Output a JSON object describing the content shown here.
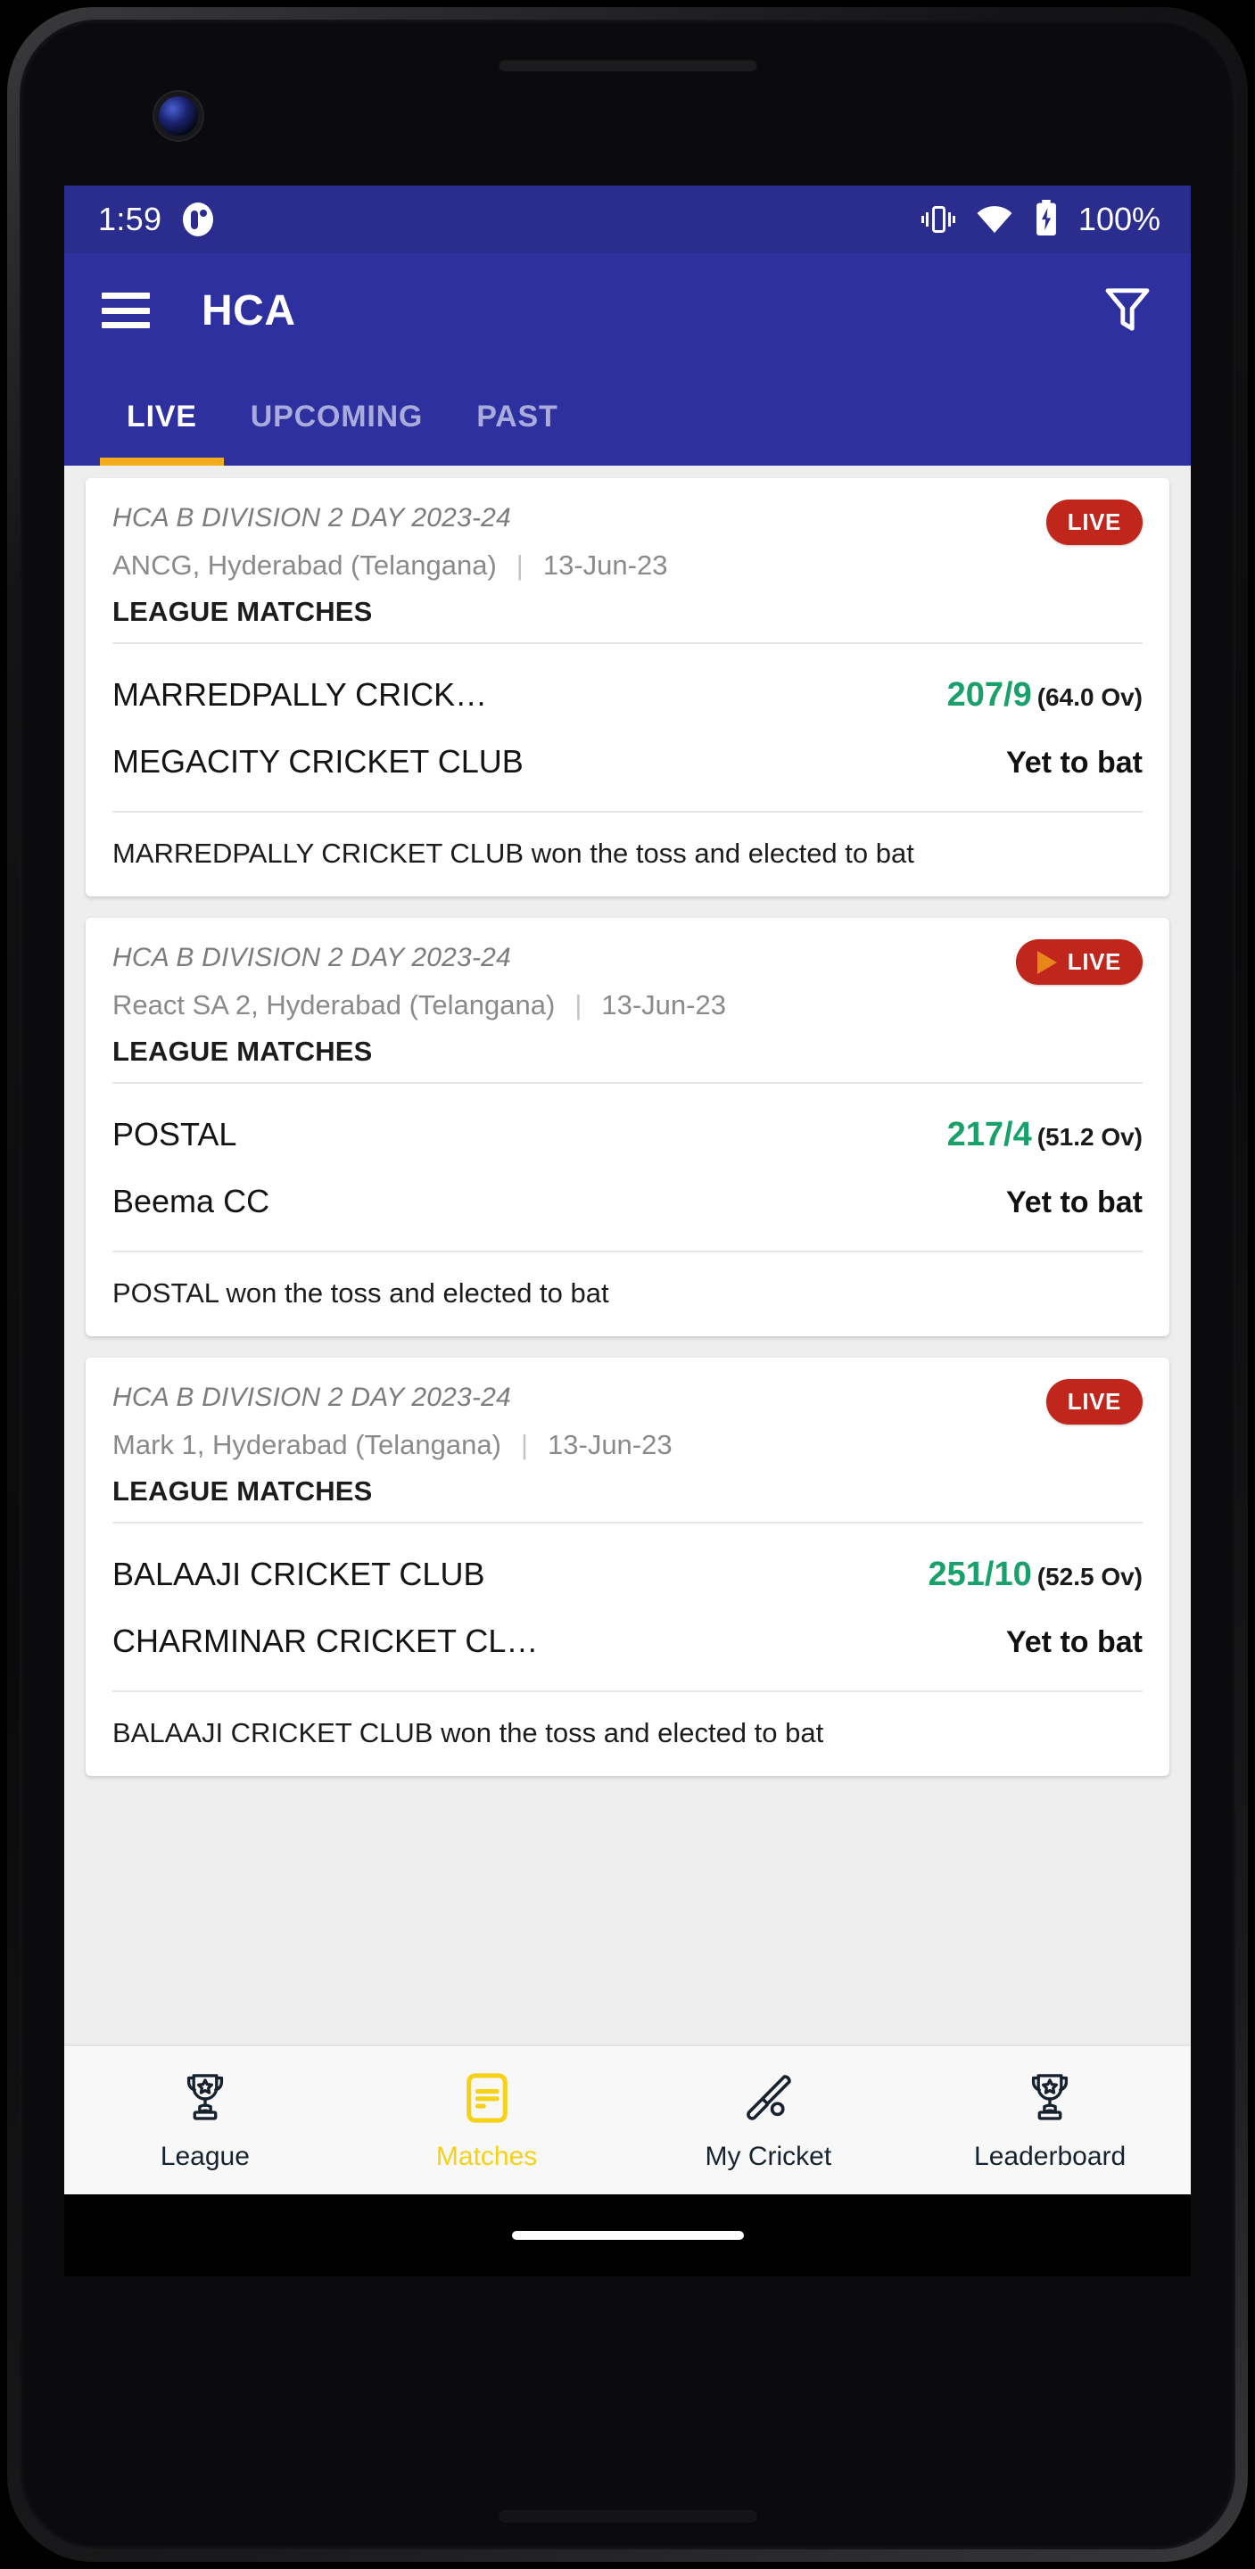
{
  "status_bar": {
    "time": "1:59",
    "notification_icon": "app-notification-icon",
    "vibrate_icon": "vibrate-icon",
    "wifi_icon": "wifi-icon",
    "battery_icon": "battery-charging-icon",
    "battery_level": "100%"
  },
  "app_bar": {
    "menu_icon": "hamburger-menu-icon",
    "title": "HCA",
    "filter_icon": "filter-icon"
  },
  "tabs": [
    {
      "label": "LIVE",
      "active": true
    },
    {
      "label": "UPCOMING",
      "active": false
    },
    {
      "label": "PAST",
      "active": false
    }
  ],
  "colors": {
    "status_bar_blue": "#2b2d8e",
    "app_bar_blue": "#2e30a0",
    "tab_indicator_yellow": "#f5ac1d",
    "live_badge_red": "#c0261b",
    "play_icon_orange": "#e8861b",
    "score_green": "#19a06b",
    "active_nav_yellow": "#f5d117",
    "page_background": "#eeeeee"
  },
  "matches": [
    {
      "tournament": "HCA B DIVISION 2 DAY 2023-24",
      "venue": "ANCG, Hyderabad (Telangana)",
      "separator": "|",
      "date": "13-Jun-23",
      "round": "LEAGUE MATCHES",
      "badge": {
        "label": "LIVE",
        "has_play_icon": false
      },
      "team_a": {
        "name": "MARREDPALLY CRICK…",
        "runs": "207/9",
        "overs": "(64.0 Ov)"
      },
      "team_b": {
        "name": "MEGACITY CRICKET CLUB",
        "status": "Yet to bat"
      },
      "toss": "MARREDPALLY CRICKET CLUB won the toss and elected to bat"
    },
    {
      "tournament": "HCA B DIVISION 2 DAY 2023-24",
      "venue": "React SA 2, Hyderabad (Telangana)",
      "separator": "|",
      "date": "13-Jun-23",
      "round": "LEAGUE MATCHES",
      "badge": {
        "label": "LIVE",
        "has_play_icon": true
      },
      "team_a": {
        "name": "POSTAL",
        "runs": "217/4",
        "overs": "(51.2 Ov)"
      },
      "team_b": {
        "name": "Beema CC",
        "status": "Yet to bat"
      },
      "toss": "POSTAL won the toss and elected to bat"
    },
    {
      "tournament": "HCA B DIVISION 2 DAY 2023-24",
      "venue": "Mark 1, Hyderabad (Telangana)",
      "separator": "|",
      "date": "13-Jun-23",
      "round": "LEAGUE MATCHES",
      "badge": {
        "label": "LIVE",
        "has_play_icon": false
      },
      "team_a": {
        "name": "BALAAJI CRICKET CLUB",
        "runs": "251/10",
        "overs": "(52.5 Ov)"
      },
      "team_b": {
        "name": "CHARMINAR CRICKET CL…",
        "status": "Yet to bat"
      },
      "toss": "BALAAJI CRICKET CLUB won the toss and elected to bat"
    }
  ],
  "bottom_nav": [
    {
      "label": "League",
      "icon": "trophy-icon",
      "active": false
    },
    {
      "label": "Matches",
      "icon": "matches-list-icon",
      "active": true
    },
    {
      "label": "My Cricket",
      "icon": "cricket-bat-ball-icon",
      "active": false
    },
    {
      "label": "Leaderboard",
      "icon": "trophy-icon",
      "active": false
    }
  ]
}
